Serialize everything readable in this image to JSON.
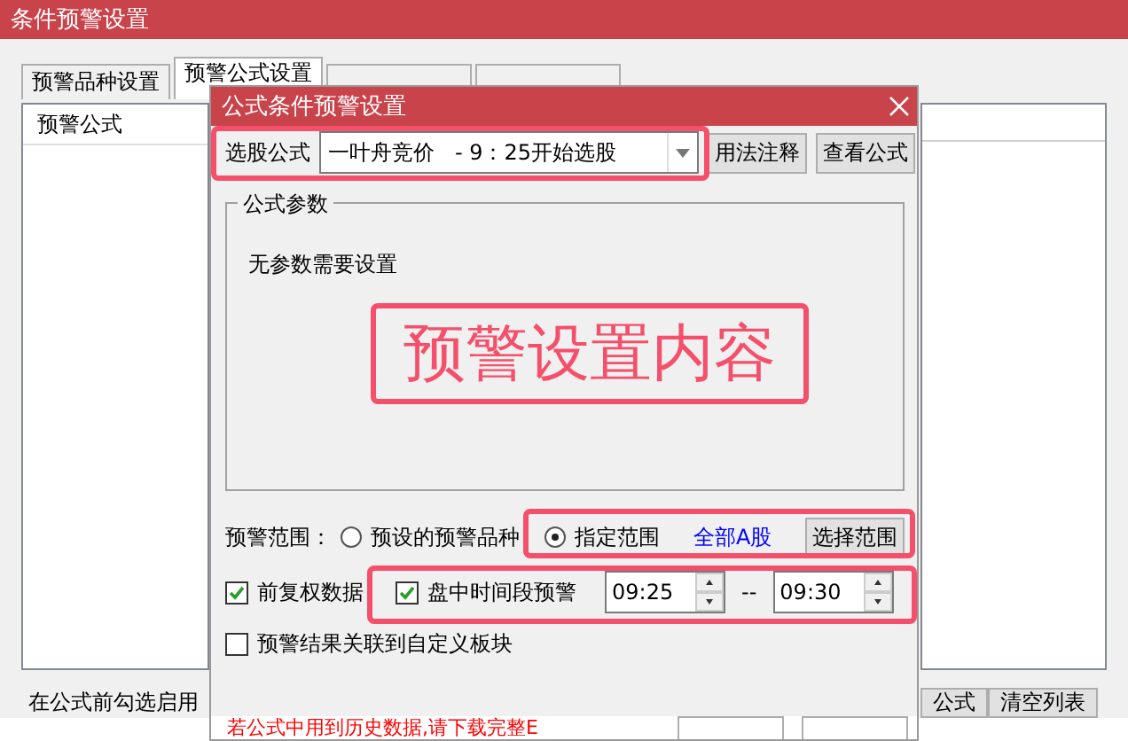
{
  "main_window": {
    "title": "条件预警设置",
    "tabs": [
      {
        "label": "预警品种设置",
        "selected": false
      },
      {
        "label": "预警公式设置",
        "selected": true
      },
      {
        "selected": false
      },
      {
        "selected": false
      }
    ],
    "formula_list": {
      "header": "预警公式"
    },
    "hint": "在公式前勾选启用",
    "buttons": [
      "公式",
      "清空列表"
    ]
  },
  "dialog": {
    "title": "公式条件预警设置",
    "formula": {
      "label": "选股公式",
      "value": "一叶舟竞价   - 9：25开始选股"
    },
    "buttons": [
      "用法注释",
      "查看公式"
    ],
    "params": {
      "title": "公式参数",
      "text": "无参数需要设置"
    },
    "annotation": "预警设置内容",
    "range": {
      "label": "预警范围：",
      "options": [
        {
          "label": "预设的预警品种",
          "selected": false
        },
        {
          "label": "指定范围",
          "selected": true
        }
      ],
      "link": "全部A股",
      "button": "选择范围"
    },
    "adjust": {
      "label": "前复权数据",
      "checked": true
    },
    "time_alert": {
      "label": "盘中时间段预警",
      "checked": true,
      "start": "09:25",
      "separator": "--",
      "end": "09:30"
    },
    "link_block": {
      "label": "预警结果关联到自定义板块",
      "checked": false
    },
    "note": "若公式中用到历史数据,请下载完整E"
  }
}
